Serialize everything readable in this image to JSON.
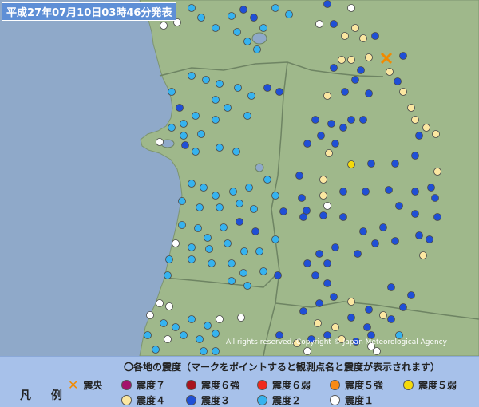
{
  "map": {
    "title": "平成27年07月10日03時46分発表",
    "copyright": "All rights reserved. Copyright © Japan Meteorological Agency"
  },
  "legend": {
    "label": "凡 例",
    "header": "〇各地の震度（マークをポイントすると観測点名と震度が表示されます）",
    "items": [
      {
        "key": "epicenter",
        "label": "震央",
        "color": "#f28a00"
      },
      {
        "key": "i7",
        "label": "震度７",
        "color": "#a4126b"
      },
      {
        "key": "i6plus",
        "label": "震度６強",
        "color": "#a8141d"
      },
      {
        "key": "i6minus",
        "label": "震度６弱",
        "color": "#ef2a1c"
      },
      {
        "key": "i5plus",
        "label": "震度５強",
        "color": "#f88a14"
      },
      {
        "key": "i5minus",
        "label": "震度５弱",
        "color": "#f5da0a"
      },
      {
        "key": "i4",
        "label": "震度４",
        "color": "#fbe7a1"
      },
      {
        "key": "i3",
        "label": "震度３",
        "color": "#1f4fd6"
      },
      {
        "key": "i2",
        "label": "震度２",
        "color": "#36b3ef"
      },
      {
        "key": "i1",
        "label": "震度１",
        "color": "#ffffff"
      }
    ]
  }
}
